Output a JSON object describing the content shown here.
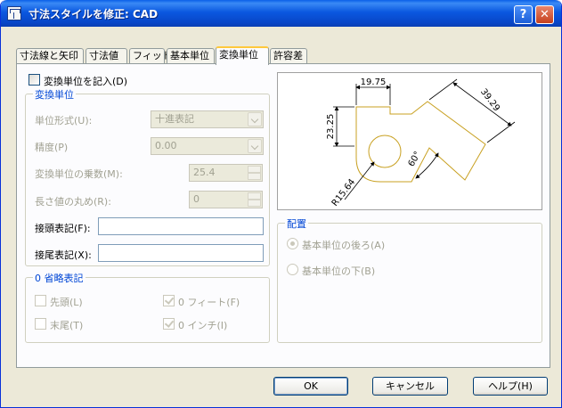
{
  "window": {
    "title": "寸法スタイルを修正: CAD",
    "help_label": "?",
    "close_label": "✕"
  },
  "tabs": [
    {
      "label": "寸法線と矢印"
    },
    {
      "label": "寸法値"
    },
    {
      "label": "フィット"
    },
    {
      "label": "基本単位"
    },
    {
      "label": "変換単位"
    },
    {
      "label": "許容差"
    }
  ],
  "display_alternate": {
    "label": "変換単位を記入(D)",
    "checked": false
  },
  "alt_units": {
    "title": "変換単位",
    "unit_format": {
      "label": "単位形式(U):",
      "value": "十進表記"
    },
    "precision": {
      "label": "精度(P)",
      "value": "0.00"
    },
    "multiplier": {
      "label": "変換単位の乗数(M):",
      "value": "25.4"
    },
    "round_off": {
      "label": "長さ値の丸め(R):",
      "value": "0"
    },
    "prefix": {
      "label": "接頭表記(F):",
      "value": ""
    },
    "suffix": {
      "label": "接尾表記(X):",
      "value": ""
    }
  },
  "zero_suppression": {
    "title": "0 省略表記",
    "leading": {
      "label": "先頭(L)",
      "checked": false
    },
    "trailing": {
      "label": "末尾(T)",
      "checked": false
    },
    "feet": {
      "label": "0 フィート(F)",
      "checked": true
    },
    "inches": {
      "label": "0 インチ(I)",
      "checked": true
    }
  },
  "preview": {
    "dim_top": "19.75",
    "dim_left": "23.25",
    "dim_right": "39.29",
    "dim_angle": "60°",
    "dim_radius": "R15.64"
  },
  "placement": {
    "title": "配置",
    "after_primary": {
      "label": "基本単位の後ろ(A)",
      "selected": true
    },
    "below_primary": {
      "label": "基本単位の下(B)",
      "selected": false
    }
  },
  "buttons": {
    "ok": "OK",
    "cancel": "キャンセル",
    "help": "ヘルプ(H)"
  },
  "colors": {
    "title_bar": "#0a5fe8",
    "group_title": "#0046d5",
    "preview_geometry": "#c8a020",
    "disabled_text": "#a1a192"
  }
}
